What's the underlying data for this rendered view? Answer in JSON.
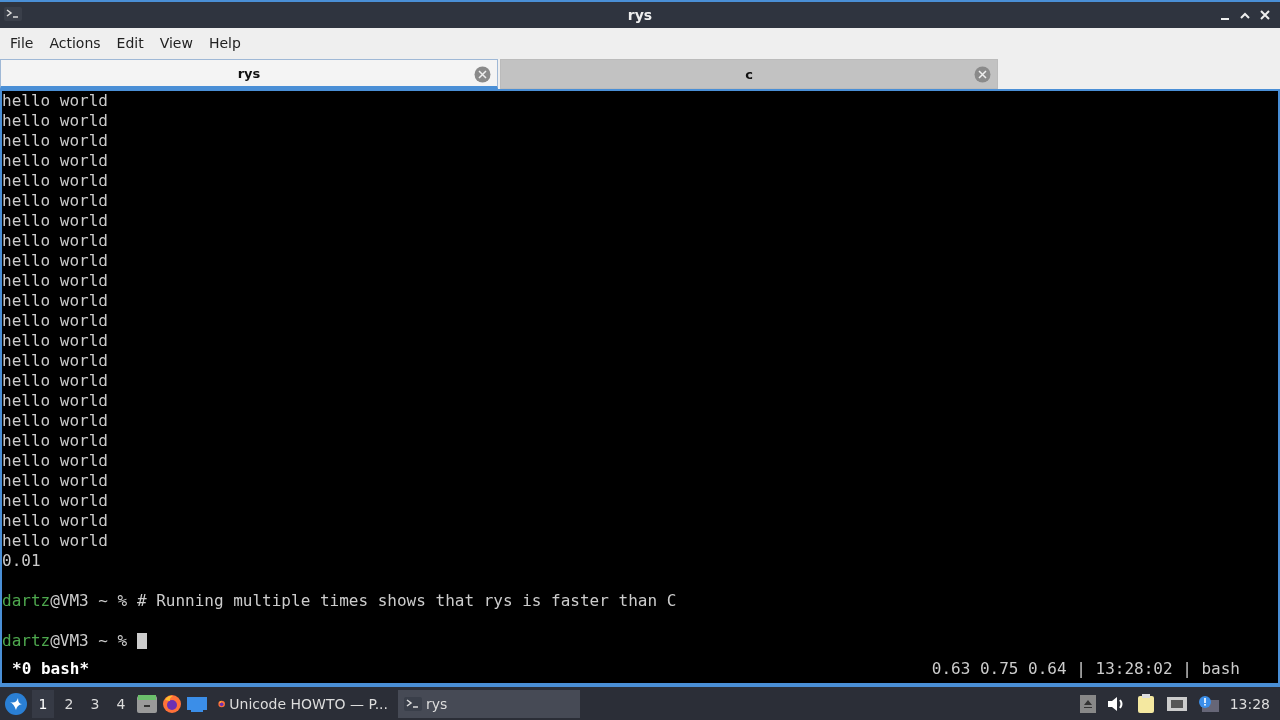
{
  "window": {
    "title": "rys"
  },
  "menu": [
    "File",
    "Actions",
    "Edit",
    "View",
    "Help"
  ],
  "tabs": [
    {
      "label": "rys",
      "selected": true
    },
    {
      "label": "c",
      "selected": false
    }
  ],
  "terminal": {
    "lines": [
      {
        "kind": "output",
        "text": "hello world"
      },
      {
        "kind": "output",
        "text": "hello world"
      },
      {
        "kind": "output",
        "text": "hello world"
      },
      {
        "kind": "output",
        "text": "hello world"
      },
      {
        "kind": "output",
        "text": "hello world"
      },
      {
        "kind": "output",
        "text": "hello world"
      },
      {
        "kind": "output",
        "text": "hello world"
      },
      {
        "kind": "output",
        "text": "hello world"
      },
      {
        "kind": "output",
        "text": "hello world"
      },
      {
        "kind": "output",
        "text": "hello world"
      },
      {
        "kind": "output",
        "text": "hello world"
      },
      {
        "kind": "output",
        "text": "hello world"
      },
      {
        "kind": "output",
        "text": "hello world"
      },
      {
        "kind": "output",
        "text": "hello world"
      },
      {
        "kind": "output",
        "text": "hello world"
      },
      {
        "kind": "output",
        "text": "hello world"
      },
      {
        "kind": "output",
        "text": "hello world"
      },
      {
        "kind": "output",
        "text": "hello world"
      },
      {
        "kind": "output",
        "text": "hello world"
      },
      {
        "kind": "output",
        "text": "hello world"
      },
      {
        "kind": "output",
        "text": "hello world"
      },
      {
        "kind": "output",
        "text": "hello world"
      },
      {
        "kind": "output",
        "text": "hello world"
      },
      {
        "kind": "output",
        "text": "0.01"
      },
      {
        "kind": "blank"
      },
      {
        "kind": "prompt",
        "user": "dartz",
        "host": "@VM3 ~ % ",
        "command": "# Running multiple times shows that rys is faster than C",
        "cursor": false
      },
      {
        "kind": "blank"
      },
      {
        "kind": "prompt",
        "user": "dartz",
        "host": "@VM3 ~ % ",
        "cursor": true
      }
    ]
  },
  "status_bar": {
    "left": "*0 bash*",
    "right": "0.63 0.75 0.64 | 13:28:02 | bash"
  },
  "taskbar": {
    "workspaces": [
      {
        "label": "1",
        "selected": true
      },
      {
        "label": "2",
        "selected": false
      },
      {
        "label": "3",
        "selected": false
      },
      {
        "label": "4",
        "selected": false
      }
    ],
    "tasks": [
      {
        "kind": "browser",
        "label": "Unicode HOWTO — P...",
        "selected": false
      },
      {
        "kind": "terminal",
        "label": "rys",
        "selected": true
      }
    ],
    "clock": "13:28"
  }
}
